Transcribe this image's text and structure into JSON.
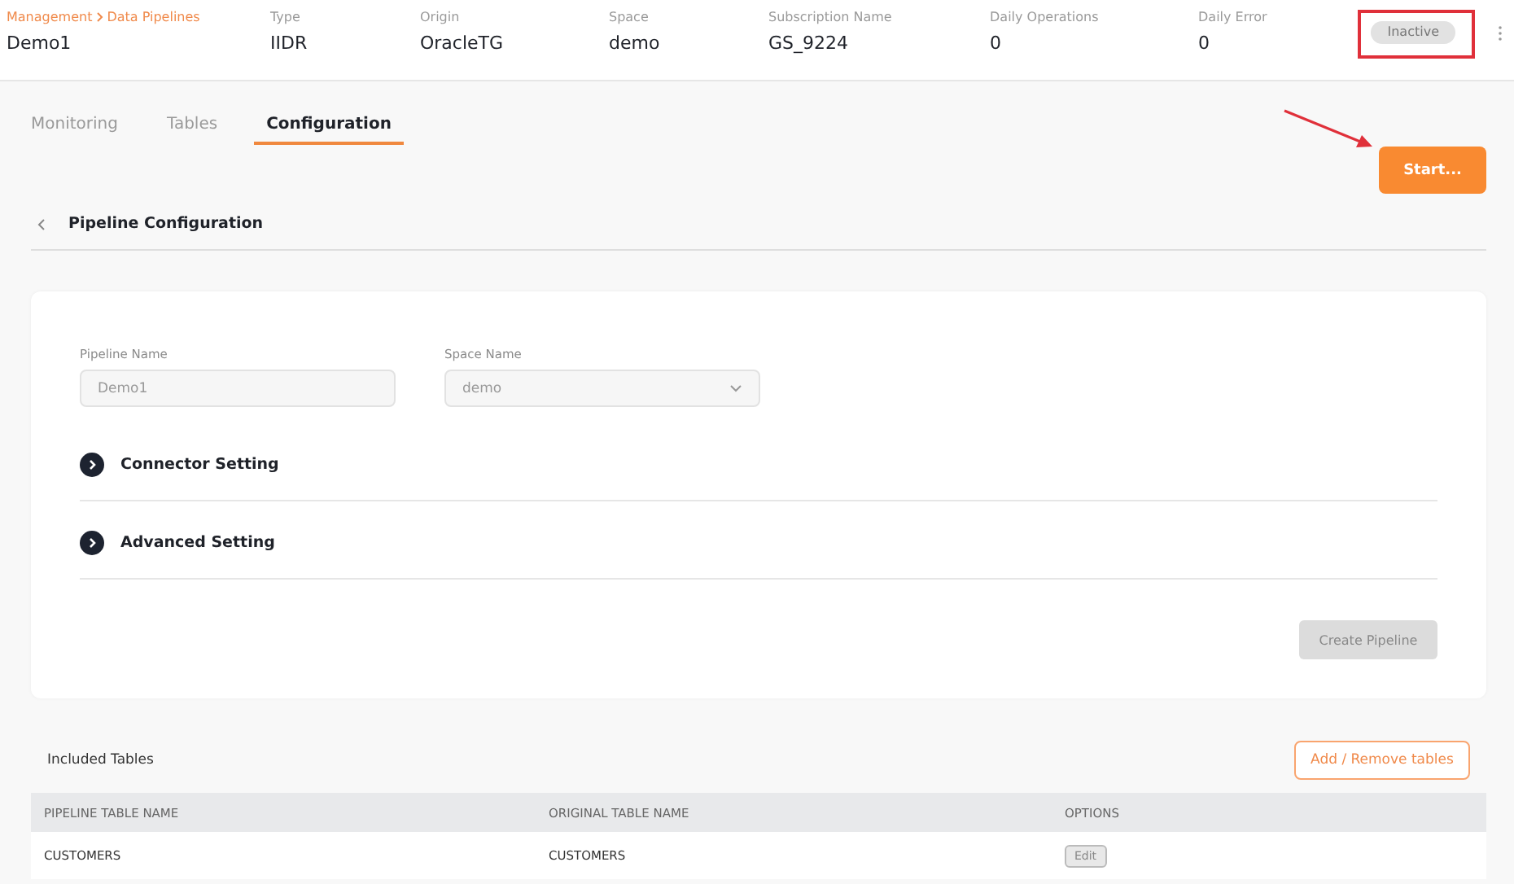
{
  "header": {
    "breadcrumb": [
      "Management",
      "Data Pipelines"
    ],
    "title": "Demo1",
    "fields": [
      {
        "label": "Type",
        "value": "IIDR"
      },
      {
        "label": "Origin",
        "value": "OracleTG"
      },
      {
        "label": "Space",
        "value": "demo"
      },
      {
        "label": "Subscription Name",
        "value": "GS_9224"
      },
      {
        "label": "Daily Operations",
        "value": "0"
      },
      {
        "label": "Daily Error",
        "value": "0"
      }
    ],
    "status": "Inactive"
  },
  "tabs": [
    {
      "label": "Monitoring",
      "selected": false
    },
    {
      "label": "Tables",
      "selected": false
    },
    {
      "label": "Configuration",
      "selected": true
    }
  ],
  "start_button": "Start...",
  "section_title": "Pipeline Configuration",
  "form": {
    "fields": [
      {
        "kind": "text",
        "label": "Pipeline Name",
        "value": "Demo1",
        "disabled": true
      },
      {
        "kind": "select",
        "label": "Space Name",
        "value": "demo",
        "disabled": true
      }
    ],
    "accordions": [
      {
        "label": "Connector Setting",
        "expanded": false
      },
      {
        "label": "Advanced Setting",
        "expanded": false
      }
    ],
    "create_button": {
      "label": "Create Pipeline",
      "disabled": true
    }
  },
  "included_tables": {
    "title": "Included Tables",
    "button": "Add / Remove tables",
    "columns": [
      "PIPELINE TABLE NAME",
      "ORIGINAL TABLE NAME",
      "OPTIONS"
    ],
    "rows": [
      {
        "pipeline_table": "CUSTOMERS",
        "original_table": "CUSTOMERS",
        "option": "Edit"
      }
    ]
  },
  "annotations": {
    "highlight_box": true,
    "arrow": true
  }
}
